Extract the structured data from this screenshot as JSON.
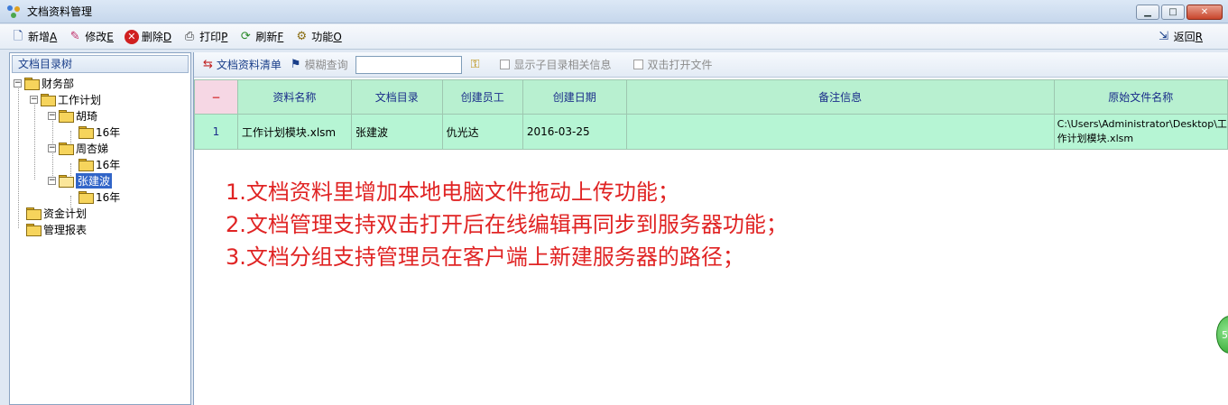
{
  "window": {
    "title": "文档资料管理",
    "minimize": "▁",
    "maximize": "□",
    "close": "✕"
  },
  "toolbar": {
    "add": "新增",
    "add_key": "A",
    "edit": "修改",
    "edit_key": "E",
    "delete": "删除",
    "delete_key": "D",
    "print": "打印",
    "print_key": "P",
    "refresh": "刷新",
    "refresh_key": "F",
    "function": "功能",
    "function_key": "O",
    "back": "返回",
    "back_key": "R"
  },
  "tree": {
    "header": "文档目录树",
    "nodes": [
      "财务部",
      "工作计划",
      "胡琦",
      "16年",
      "周杏娣",
      "16年",
      "张建波",
      "16年",
      "资金计划",
      "管理报表"
    ]
  },
  "subbar": {
    "list": "文档资料清单",
    "fuzzy_search": "模糊查询",
    "search_value": "",
    "show_sub": "显示子目录相关信息",
    "dblclick_open": "双击打开文件"
  },
  "grid": {
    "corner": "−",
    "columns": [
      "资料名称",
      "文档目录",
      "创建员工",
      "创建日期",
      "备注信息",
      "原始文件名称"
    ],
    "rows": [
      {
        "num": "1",
        "name": "工作计划模块.xlsm",
        "dir": "张建波",
        "creator": "仇光达",
        "date": "2016-03-25",
        "remark": "",
        "origin": "C:\\Users\\Administrator\\Desktop\\工作计划模块.xlsm"
      }
    ]
  },
  "notes": [
    "1.文档资料里增加本地电脑文件拖动上传功能；",
    "2.文档管理支持双击打开后在线编辑再同步到服务器功能；",
    "3.文档分组支持管理员在客户端上新建服务器的路径；"
  ],
  "badge": "5",
  "colors": {
    "grid_green": "#b6f5d4",
    "note_red": "#e02424",
    "selection_blue": "#3165c8"
  }
}
